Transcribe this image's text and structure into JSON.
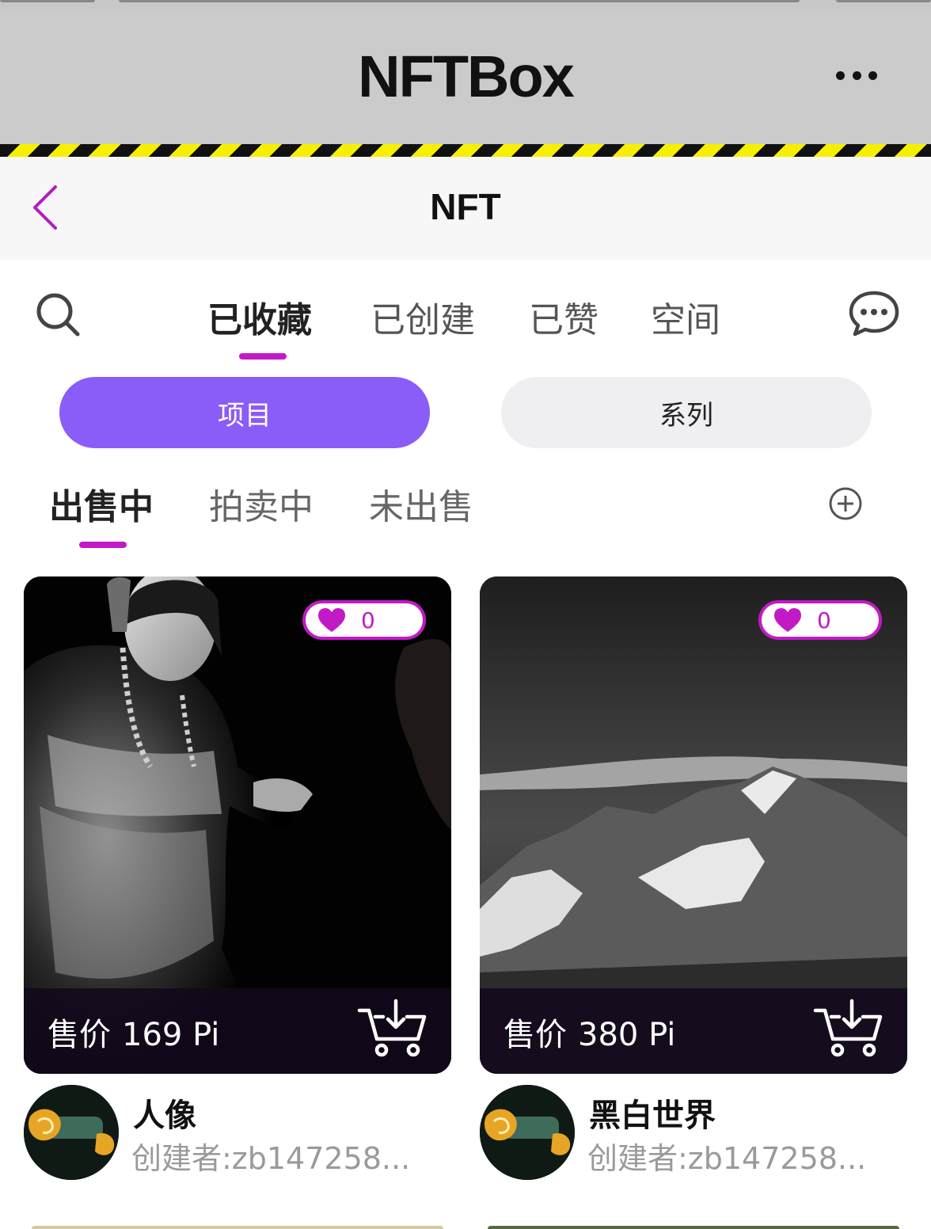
{
  "header": {
    "app_title": "NFTBox",
    "more_icon": "more-dots-icon"
  },
  "navbar": {
    "title": "NFT",
    "back_icon": "chevron-left-icon"
  },
  "main_tabs": {
    "items": [
      {
        "label": "已收藏",
        "active": true
      },
      {
        "label": "已创建",
        "active": false
      },
      {
        "label": "已赞",
        "active": false
      },
      {
        "label": "空间",
        "active": false
      }
    ],
    "search_icon": "search-icon",
    "chat_icon": "chat-bubble-icon"
  },
  "segments": {
    "items": [
      {
        "label": "项目",
        "active": true
      },
      {
        "label": "系列",
        "active": false
      }
    ]
  },
  "sub_tabs": {
    "items": [
      {
        "label": "出售中",
        "active": true
      },
      {
        "label": "拍卖中",
        "active": false
      },
      {
        "label": "未出售",
        "active": false
      }
    ],
    "add_icon": "plus-circle-icon"
  },
  "cards": [
    {
      "likes": "0",
      "price_label": "售价",
      "price": "169 Pi",
      "name": "人像",
      "creator": "创建者:zb147258...",
      "image": "portrait-photo"
    },
    {
      "likes": "0",
      "price_label": "售价",
      "price": "380 Pi",
      "name": "黑白世界",
      "creator": "创建者:zb147258...",
      "image": "mountain-photo"
    }
  ],
  "colors": {
    "accent_magenta": "#c21ac7",
    "segment_active": "#8a5cf8",
    "header_bg": "#cbcbcb",
    "hazard_yellow": "#f6ef00"
  }
}
